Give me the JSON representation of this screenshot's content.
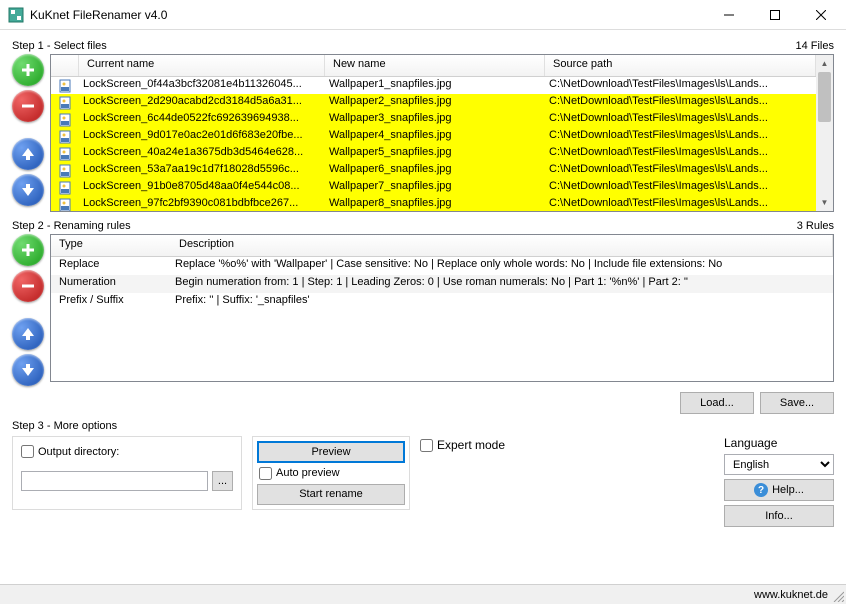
{
  "window": {
    "title": "KuKnet FileRenamer v4.0"
  },
  "step1": {
    "label": "Step 1 - Select files",
    "count_label": "14 Files",
    "columns": {
      "current": "Current name",
      "new": "New name",
      "path": "Source path"
    },
    "files": [
      {
        "current": "LockScreen_0f44a3bcf32081e4b11326045...",
        "new": "Wallpaper1_snapfiles.jpg",
        "path": "C:\\NetDownload\\TestFiles\\Images\\ls\\Lands...",
        "hl": false
      },
      {
        "current": "LockScreen_2d290acabd2cd3184d5a6a31...",
        "new": "Wallpaper2_snapfiles.jpg",
        "path": "C:\\NetDownload\\TestFiles\\Images\\ls\\Lands...",
        "hl": true
      },
      {
        "current": "LockScreen_6c44de0522fc692639694938...",
        "new": "Wallpaper3_snapfiles.jpg",
        "path": "C:\\NetDownload\\TestFiles\\Images\\ls\\Lands...",
        "hl": true
      },
      {
        "current": "LockScreen_9d017e0ac2e01d6f683e20fbe...",
        "new": "Wallpaper4_snapfiles.jpg",
        "path": "C:\\NetDownload\\TestFiles\\Images\\ls\\Lands...",
        "hl": true
      },
      {
        "current": "LockScreen_40a24e1a3675db3d5464e628...",
        "new": "Wallpaper5_snapfiles.jpg",
        "path": "C:\\NetDownload\\TestFiles\\Images\\ls\\Lands...",
        "hl": true
      },
      {
        "current": "LockScreen_53a7aa19c1d7f18028d5596c...",
        "new": "Wallpaper6_snapfiles.jpg",
        "path": "C:\\NetDownload\\TestFiles\\Images\\ls\\Lands...",
        "hl": true
      },
      {
        "current": "LockScreen_91b0e8705d48aa0f4e544c08...",
        "new": "Wallpaper7_snapfiles.jpg",
        "path": "C:\\NetDownload\\TestFiles\\Images\\ls\\Lands...",
        "hl": true
      },
      {
        "current": "LockScreen_97fc2bf9390c081bdbfbce267...",
        "new": "Wallpaper8_snapfiles.jpg",
        "path": "C:\\NetDownload\\TestFiles\\Images\\ls\\Lands...",
        "hl": true
      }
    ]
  },
  "step2": {
    "label": "Step 2 - Renaming rules",
    "count_label": "3 Rules",
    "columns": {
      "type": "Type",
      "desc": "Description"
    },
    "rules": [
      {
        "type": "Replace",
        "desc": "Replace '%o%' with 'Wallpaper' | Case sensitive: No | Replace only whole words: No | Include file extensions: No"
      },
      {
        "type": "Numeration",
        "desc": "Begin numeration from: 1 | Step: 1 | Leading Zeros: 0 | Use roman numerals: No | Part 1: '%n%' | Part 2: ''"
      },
      {
        "type": "Prefix / Suffix",
        "desc": "Prefix: '' | Suffix: '_snapfiles'"
      }
    ],
    "load_btn": "Load...",
    "save_btn": "Save..."
  },
  "step3": {
    "label": "Step 3 - More options",
    "output_dir_label": "Output directory:",
    "preview_btn": "Preview",
    "auto_preview_label": "Auto preview",
    "start_btn": "Start rename",
    "expert_label": "Expert mode",
    "language_label": "Language",
    "language_value": "English",
    "help_btn": "Help...",
    "info_btn": "Info..."
  },
  "status": {
    "url": "www.kuknet.de"
  }
}
